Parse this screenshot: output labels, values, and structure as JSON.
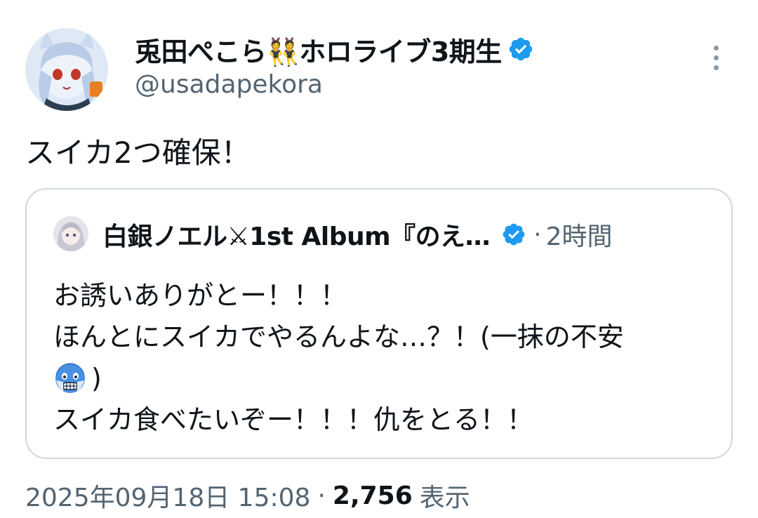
{
  "author": {
    "display_name": "兎田ぺこら👯ホロライブ3期生",
    "handle": "@usadapekora",
    "verified_icon": "verified-badge-icon",
    "accent_color": "#1d9bf0"
  },
  "more_icon": "more-vertical-icon",
  "tweet_text": "スイカ2つ確保！",
  "quote": {
    "display_name": "白銀ノエル⚔1st Album『のえ…",
    "verified_icon": "verified-badge-icon",
    "separator": "·",
    "time": "2時間",
    "lines": [
      "お誘いありがとー！！！",
      "ほんとにスイカでやるんよな…？！(一抹の不安",
      ")",
      "スイカ食べたいぞー！！！仇をとる！！"
    ],
    "emoji": "fearful-face-emoji"
  },
  "footer": {
    "timestamp": "2025年09月18日 15:08",
    "separator": "·",
    "views_count": "2,756",
    "views_label": "表示"
  }
}
